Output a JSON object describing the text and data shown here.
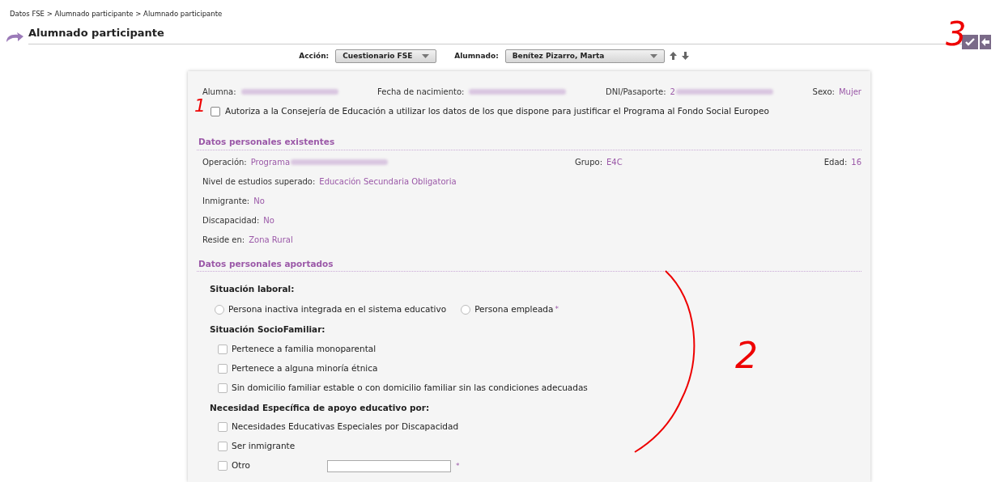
{
  "breadcrumb": "Datos FSE > Alumnado participante > Alumnado participante",
  "title": "Alumnado participante",
  "toolbar": {
    "accion": {
      "label": "Acción:",
      "value": "Cuestionario FSE"
    },
    "alumnado": {
      "label": "Alumnado:",
      "value": "Benítez Pizarro, Marta"
    }
  },
  "header_fields": [
    {
      "label": "Alumna:",
      "redacted": true
    },
    {
      "label": "Fecha de nacimiento:",
      "redacted": true
    },
    {
      "label": "DNI/Pasaporte:",
      "value": "2",
      "redacted": true
    },
    {
      "label": "Sexo:",
      "value": "Mujer"
    }
  ],
  "consent": {
    "label": "Autoriza a la Consejería de Educación a utilizar los datos de los que dispone para justificar el Programa al Fondo Social Europeo",
    "checked": false
  },
  "existing": {
    "title": "Datos personales existentes",
    "rows": [
      [
        {
          "label": "Operación:",
          "value": "Programa",
          "redacted": true
        },
        {
          "label": "Grupo:",
          "value": "E4C"
        },
        {
          "label": "Edad:",
          "value": "16"
        }
      ],
      [
        {
          "label": "Nivel de estudios superado:",
          "value": "Educación Secundaria Obligatoria"
        }
      ],
      [
        {
          "label": "Inmigrante:",
          "value": "No"
        }
      ],
      [
        {
          "label": "Discapacidad:",
          "value": "No"
        }
      ],
      [
        {
          "label": "Reside en:",
          "value": "Zona Rural"
        }
      ]
    ]
  },
  "provided": {
    "title": "Datos personales aportados",
    "groups": [
      {
        "title": "Situación laboral:",
        "kind": "radio",
        "required_mark": "*",
        "options": [
          {
            "label": "Persona inactiva integrada en el sistema educativo",
            "selected": false
          },
          {
            "label": "Persona empleada",
            "selected": false
          }
        ]
      },
      {
        "title": "Situación SocioFamiliar:",
        "kind": "checkbox",
        "options": [
          {
            "label": "Pertenece a familia monoparental",
            "checked": false
          },
          {
            "label": "Pertenece a alguna minoría étnica",
            "checked": false
          },
          {
            "label": "Sin domicilio familiar estable o con domicilio familiar sin las condiciones adecuadas",
            "checked": false
          }
        ]
      },
      {
        "title": "Necesidad Específica de apoyo educativo por:",
        "kind": "checkbox",
        "options": [
          {
            "label": "Necesidades Educativas Especiales por Discapacidad",
            "checked": false
          },
          {
            "label": "Ser inmigrante",
            "checked": false
          },
          {
            "label": "Otro",
            "checked": false,
            "has_input": true,
            "required_mark": "*"
          }
        ]
      }
    ]
  },
  "annotations": [
    "1",
    "2",
    "3"
  ]
}
